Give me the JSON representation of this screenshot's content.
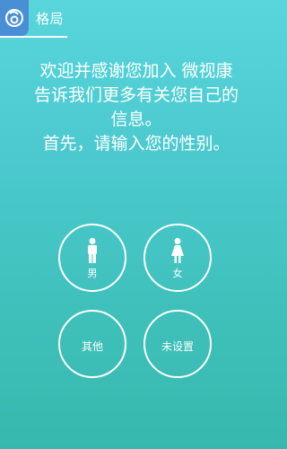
{
  "header": {
    "title": "格局",
    "logo_icon": "app-logo-icon"
  },
  "intro": {
    "line1": "欢迎并感谢您加入 微视康",
    "line2": "告诉我们更多有关您自己的",
    "line3": "信息。",
    "line4": "首先，请输入您的性别。"
  },
  "gender_options": {
    "male": "男",
    "female": "女",
    "other": "其他",
    "unset": "未设置"
  },
  "colors": {
    "background_top": "#58d6dc",
    "background_bottom": "#37b8ae",
    "logo_bg": "#4a8fd6",
    "foreground": "#ffffff"
  }
}
